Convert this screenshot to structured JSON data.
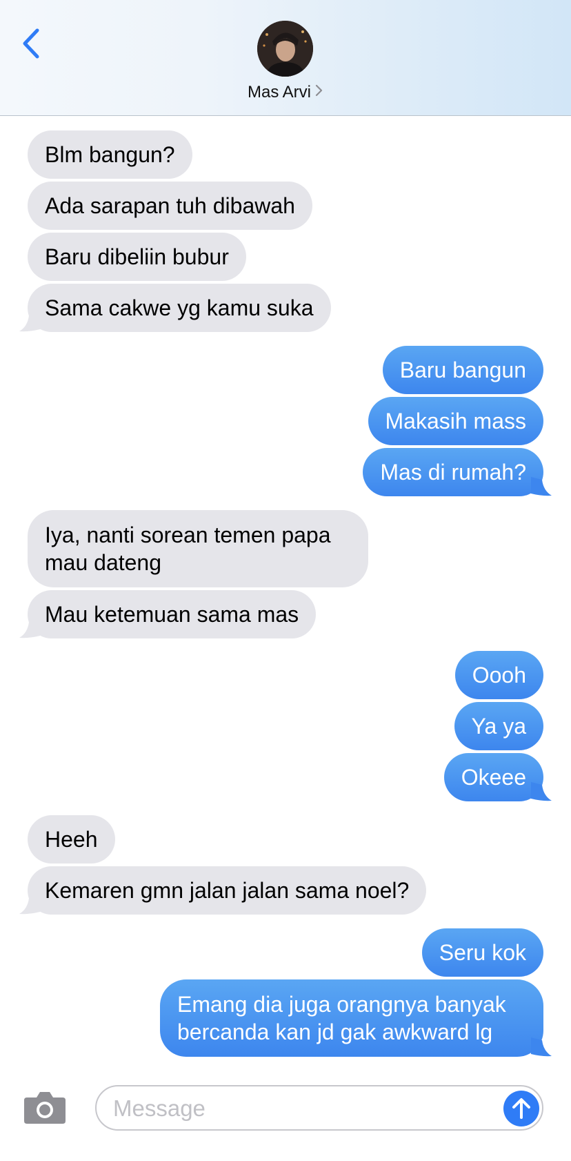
{
  "header": {
    "contact_name": "Mas Arvi"
  },
  "messages": [
    {
      "side": "in",
      "text": "Blm bangun?"
    },
    {
      "side": "in",
      "text": "Ada sarapan tuh dibawah"
    },
    {
      "side": "in",
      "text": "Baru dibeliin bubur"
    },
    {
      "side": "in",
      "text": "Sama cakwe yg kamu suka"
    },
    {
      "side": "out",
      "text": "Baru bangun"
    },
    {
      "side": "out",
      "text": "Makasih mass"
    },
    {
      "side": "out",
      "text": "Mas di rumah?"
    },
    {
      "side": "in",
      "text": "Iya, nanti sorean temen papa mau dateng"
    },
    {
      "side": "in",
      "text": "Mau ketemuan sama mas"
    },
    {
      "side": "out",
      "text": "Oooh"
    },
    {
      "side": "out",
      "text": "Ya ya"
    },
    {
      "side": "out",
      "text": "Okeee"
    },
    {
      "side": "in",
      "text": "Heeh"
    },
    {
      "side": "in",
      "text": "Kemaren gmn jalan jalan sama noel?"
    },
    {
      "side": "out",
      "text": "Seru kok"
    },
    {
      "side": "out",
      "text": "Emang dia juga orangnya banyak bercanda kan jd gak awkward lg"
    }
  ],
  "input": {
    "placeholder": "Message",
    "value": ""
  },
  "colors": {
    "incoming_bubble": "#e5e5ea",
    "outgoing_bubble": "#3d86ee",
    "accent": "#2f7cf6"
  }
}
